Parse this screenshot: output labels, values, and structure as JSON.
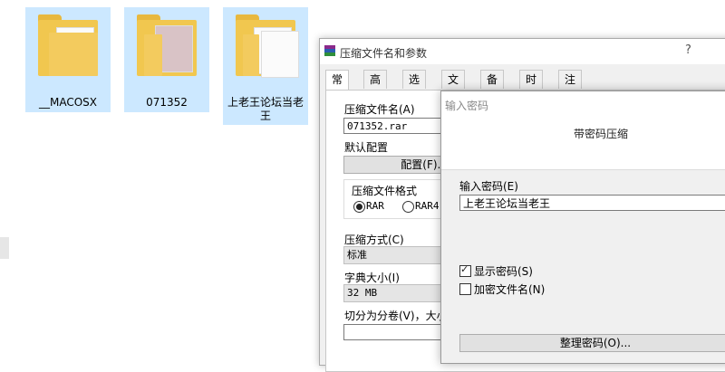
{
  "explorer": {
    "files": [
      {
        "name": "__MACOSX"
      },
      {
        "name": "071352"
      },
      {
        "name": "上老王论坛当老王"
      }
    ]
  },
  "winrar": {
    "title": "压缩文件名和参数",
    "help": "?",
    "tabs": [
      "常规",
      "高级",
      "选项",
      "文件",
      "备份",
      "时间",
      "注释"
    ],
    "archive_name_label": "压缩文件名(A)",
    "archive_name_value": "071352.rar",
    "default_profile_label": "默认配置",
    "profile_button": "配置(F)...",
    "format_group_label": "压缩文件格式",
    "format_rar": "RAR",
    "format_rar4": "RAR4",
    "method_label": "压缩方式(C)",
    "method_value": "标准",
    "dict_label": "字典大小(I)",
    "dict_value": "32 MB",
    "split_label": "切分为分卷(V)，大小"
  },
  "password_dialog": {
    "title": "输入密码",
    "header": "带密码压缩",
    "password_label": "输入密码(E)",
    "password_value": "上老王论坛当老王",
    "show_password": "显示密码(S)",
    "encrypt_names": "加密文件名(N)",
    "organize_button": "整理密码(O)...",
    "show_password_checked": true,
    "encrypt_names_checked": false
  }
}
